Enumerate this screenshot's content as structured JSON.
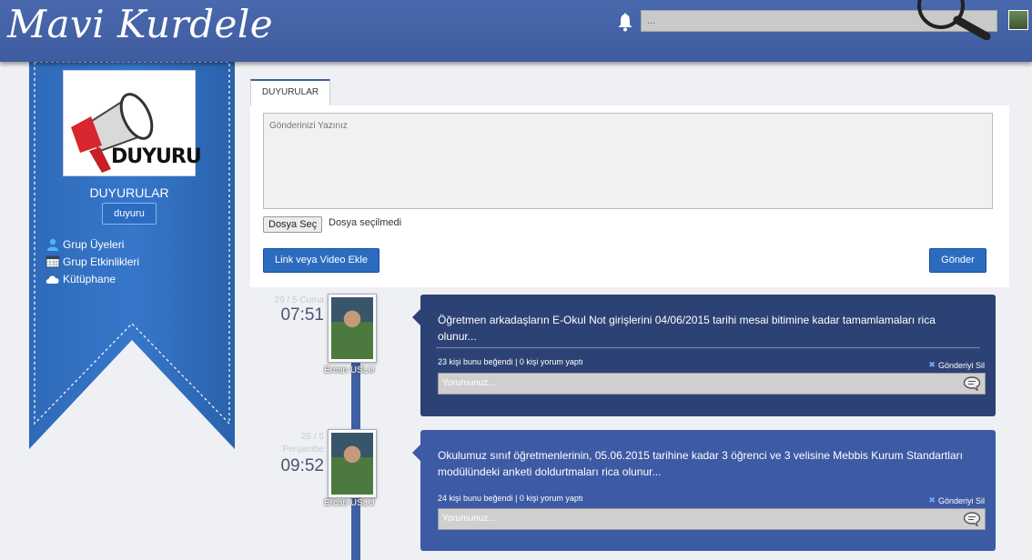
{
  "header": {
    "logo": "Mavi Kurdele",
    "search_placeholder": "..."
  },
  "group": {
    "poster_text": "DUYURU",
    "title": "DUYURULAR",
    "tag": "duyuru",
    "menu": [
      {
        "label": "Grup Üyeleri",
        "icon": "user-icon"
      },
      {
        "label": "Grup Etkinlikleri",
        "icon": "calendar-icon"
      },
      {
        "label": "Kütüphane",
        "icon": "cloud-icon"
      }
    ]
  },
  "compose": {
    "tab_label": "DUYURULAR",
    "placeholder": "Gönderinizi Yazınız",
    "file_button": "Dosya Seç",
    "file_status": "Dosya seçilmedi",
    "link_button": "Link veya Video Ekle",
    "send_button": "Gönder"
  },
  "posts": [
    {
      "date": "29 / 5 Cuma",
      "time": "07:51",
      "author": "Ercan USLU",
      "message": "Öğretmen arkadaşların E-Okul Not girişlerini 04/06/2015 tarihi mesai bitimine kadar tamamlamaları rica olunur...",
      "stats": "23 kişi bunu beğendi | 0 kişi yorum yaptı",
      "delete_label": "Gönderiyi Sil",
      "comment_placeholder": "Yorumunuz..."
    },
    {
      "date": "28 / 5 Perşembe",
      "time": "09:52",
      "author": "Ercan USLU",
      "message": "Okulumuz sınıf öğretmenlerinin, 05.06.2015 tarihine kadar 3 öğrenci ve 3 velisine Mebbis Kurum Standartları modülündeki anketi doldurtmaları rica olunur...",
      "stats": "24 kişi bunu beğendi | 0 kişi yorum yaptı",
      "delete_label": "Gönderiyi Sil",
      "comment_placeholder": "Yorumunuz..."
    }
  ],
  "colors": {
    "header": "#4a68ad",
    "ribbon": "#2f65b5",
    "card_dark": "#2d4274",
    "card_light": "#3d5aa4",
    "button": "#2c6cc0"
  }
}
